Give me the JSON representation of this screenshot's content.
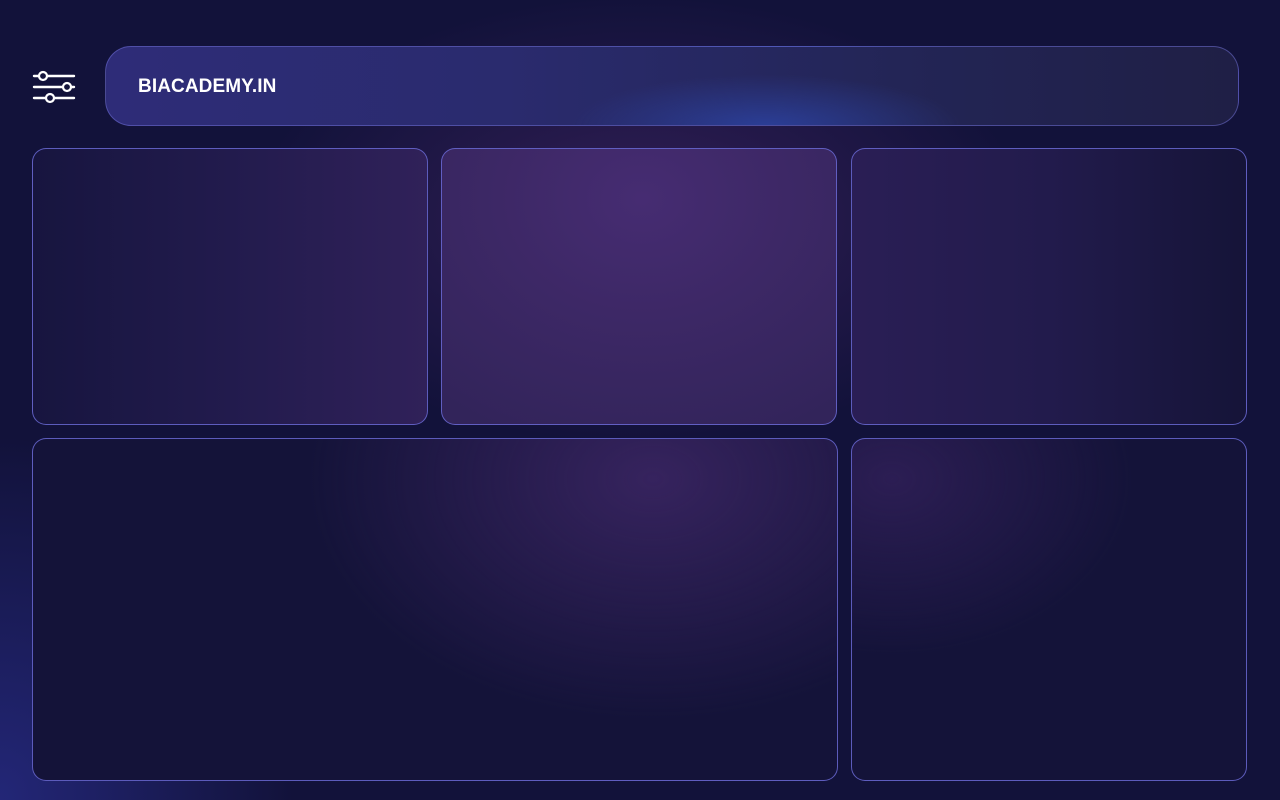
{
  "header": {
    "brand": "BIACADEMY.IN"
  },
  "icons": {
    "filter": "sliders-icon"
  },
  "colors": {
    "background": "#12123a",
    "panel_border": "#6868d2",
    "text": "#ffffff"
  }
}
